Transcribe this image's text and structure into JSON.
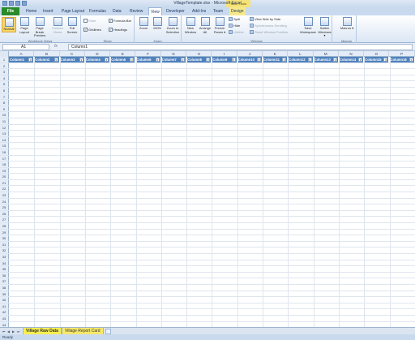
{
  "window": {
    "title": "VillageTemplate.xlsx - Microsoft Excel",
    "context_tools": "Table Tools"
  },
  "tabs": [
    "File",
    "Home",
    "Insert",
    "Page Layout",
    "Formulas",
    "Data",
    "Review",
    "View",
    "Developer",
    "Add-Ins",
    "Team",
    "Design"
  ],
  "active_tab": "View",
  "ribbon": {
    "groups": {
      "workbook_views": "Workbook Views",
      "show": "Show",
      "zoom": "Zoom",
      "window": "Window",
      "macros": "Macros"
    },
    "workbook_views": [
      {
        "label": "Normal"
      },
      {
        "label": "Page Layout"
      },
      {
        "label": "Page Break Preview"
      },
      {
        "label": "Custom Views"
      },
      {
        "label": "Full Screen"
      }
    ],
    "show": {
      "ruler": "Ruler",
      "gridlines": "Gridlines",
      "formula_bar": "Formula Bar",
      "headings": "Headings"
    },
    "zoom": [
      {
        "label": "Zoom"
      },
      {
        "label": "100%"
      },
      {
        "label": "Zoom to Selection"
      }
    ],
    "window": {
      "new_window": "New Window",
      "arrange_all": "Arrange All",
      "freeze_panes": "Freeze Panes",
      "split": "Split",
      "hide": "Hide",
      "unhide": "Unhide",
      "view_side_by_side": "View Side by Side",
      "sync_scrolling": "Synchronous Scrolling",
      "reset_position": "Reset Window Position",
      "save_workspace": "Save Workspace",
      "switch_windows": "Switch Windows"
    },
    "macros": "Macros"
  },
  "formula_bar": {
    "name_box": "A1",
    "fx": "fx",
    "content": "Column1"
  },
  "grid": {
    "columns": [
      "A",
      "B",
      "C",
      "D",
      "E",
      "F",
      "G",
      "H",
      "I",
      "J",
      "K",
      "L",
      "M",
      "N",
      "O",
      "P"
    ],
    "header_cells": [
      "Column1",
      "Column2",
      "Column3",
      "Column4",
      "Column5",
      "Column6",
      "Column7",
      "Column8",
      "Column9",
      "Column10",
      "Column11",
      "Column12",
      "Column13",
      "Column14",
      "Column15",
      "Column16"
    ]
  },
  "sheets": [
    "Village Raw Data",
    "Village Report Card"
  ],
  "active_sheet": "Village Raw Data",
  "status": "Ready"
}
